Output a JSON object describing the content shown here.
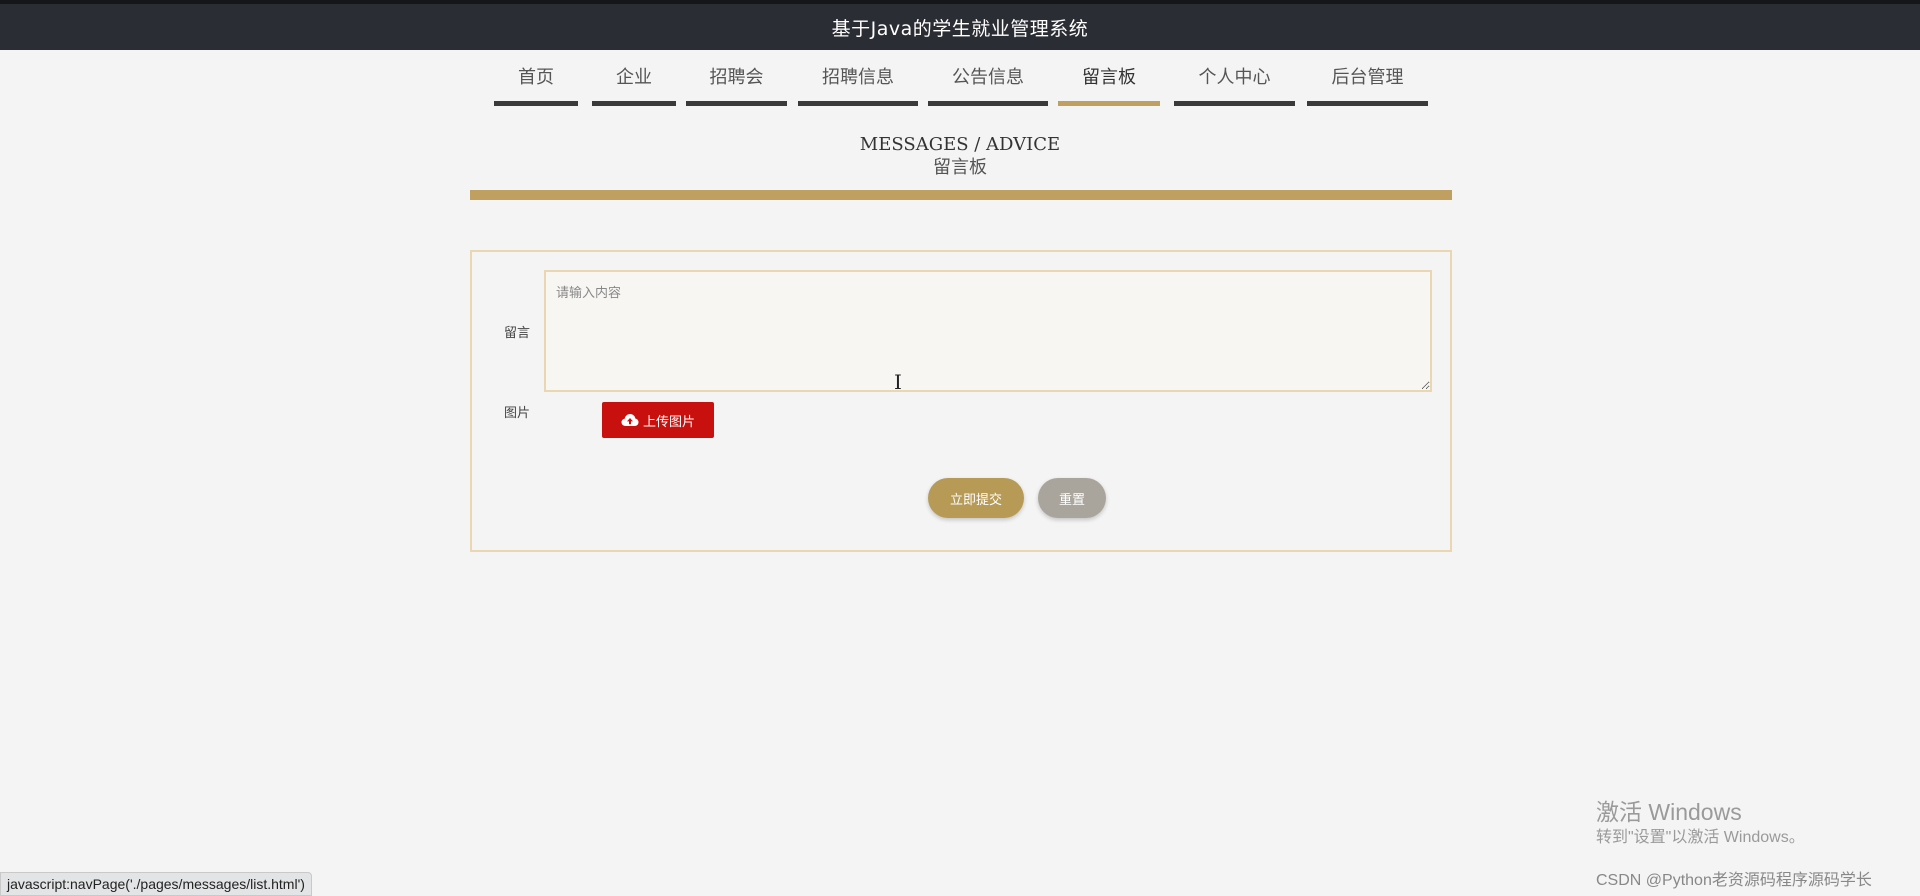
{
  "header": {
    "title": "基于Java的学生就业管理系统"
  },
  "nav": {
    "items": [
      {
        "label": "首页"
      },
      {
        "label": "企业"
      },
      {
        "label": "招聘会"
      },
      {
        "label": "招聘信息"
      },
      {
        "label": "公告信息"
      },
      {
        "label": "留言板",
        "active": true
      },
      {
        "label": "个人中心"
      },
      {
        "label": "后台管理"
      }
    ]
  },
  "section": {
    "title_en": "MESSAGES / ADVICE",
    "title_zh": "留言板"
  },
  "form": {
    "message_label": "留言",
    "message_placeholder": "请输入内容",
    "message_value": "",
    "image_label": "图片",
    "upload_label": "上传图片",
    "submit_label": "立即提交",
    "reset_label": "重置"
  },
  "colors": {
    "accent_gold": "#c0a060",
    "upload_red": "#c8110e",
    "header_bg": "#2a2d33"
  },
  "statusbar": {
    "text": "javascript:navPage('./pages/messages/list.html')"
  },
  "watermark": {
    "line1": "激活 Windows",
    "line2": "转到\"设置\"以激活 Windows。",
    "csdn": "CSDN @Python老资源码程序源码学长"
  }
}
